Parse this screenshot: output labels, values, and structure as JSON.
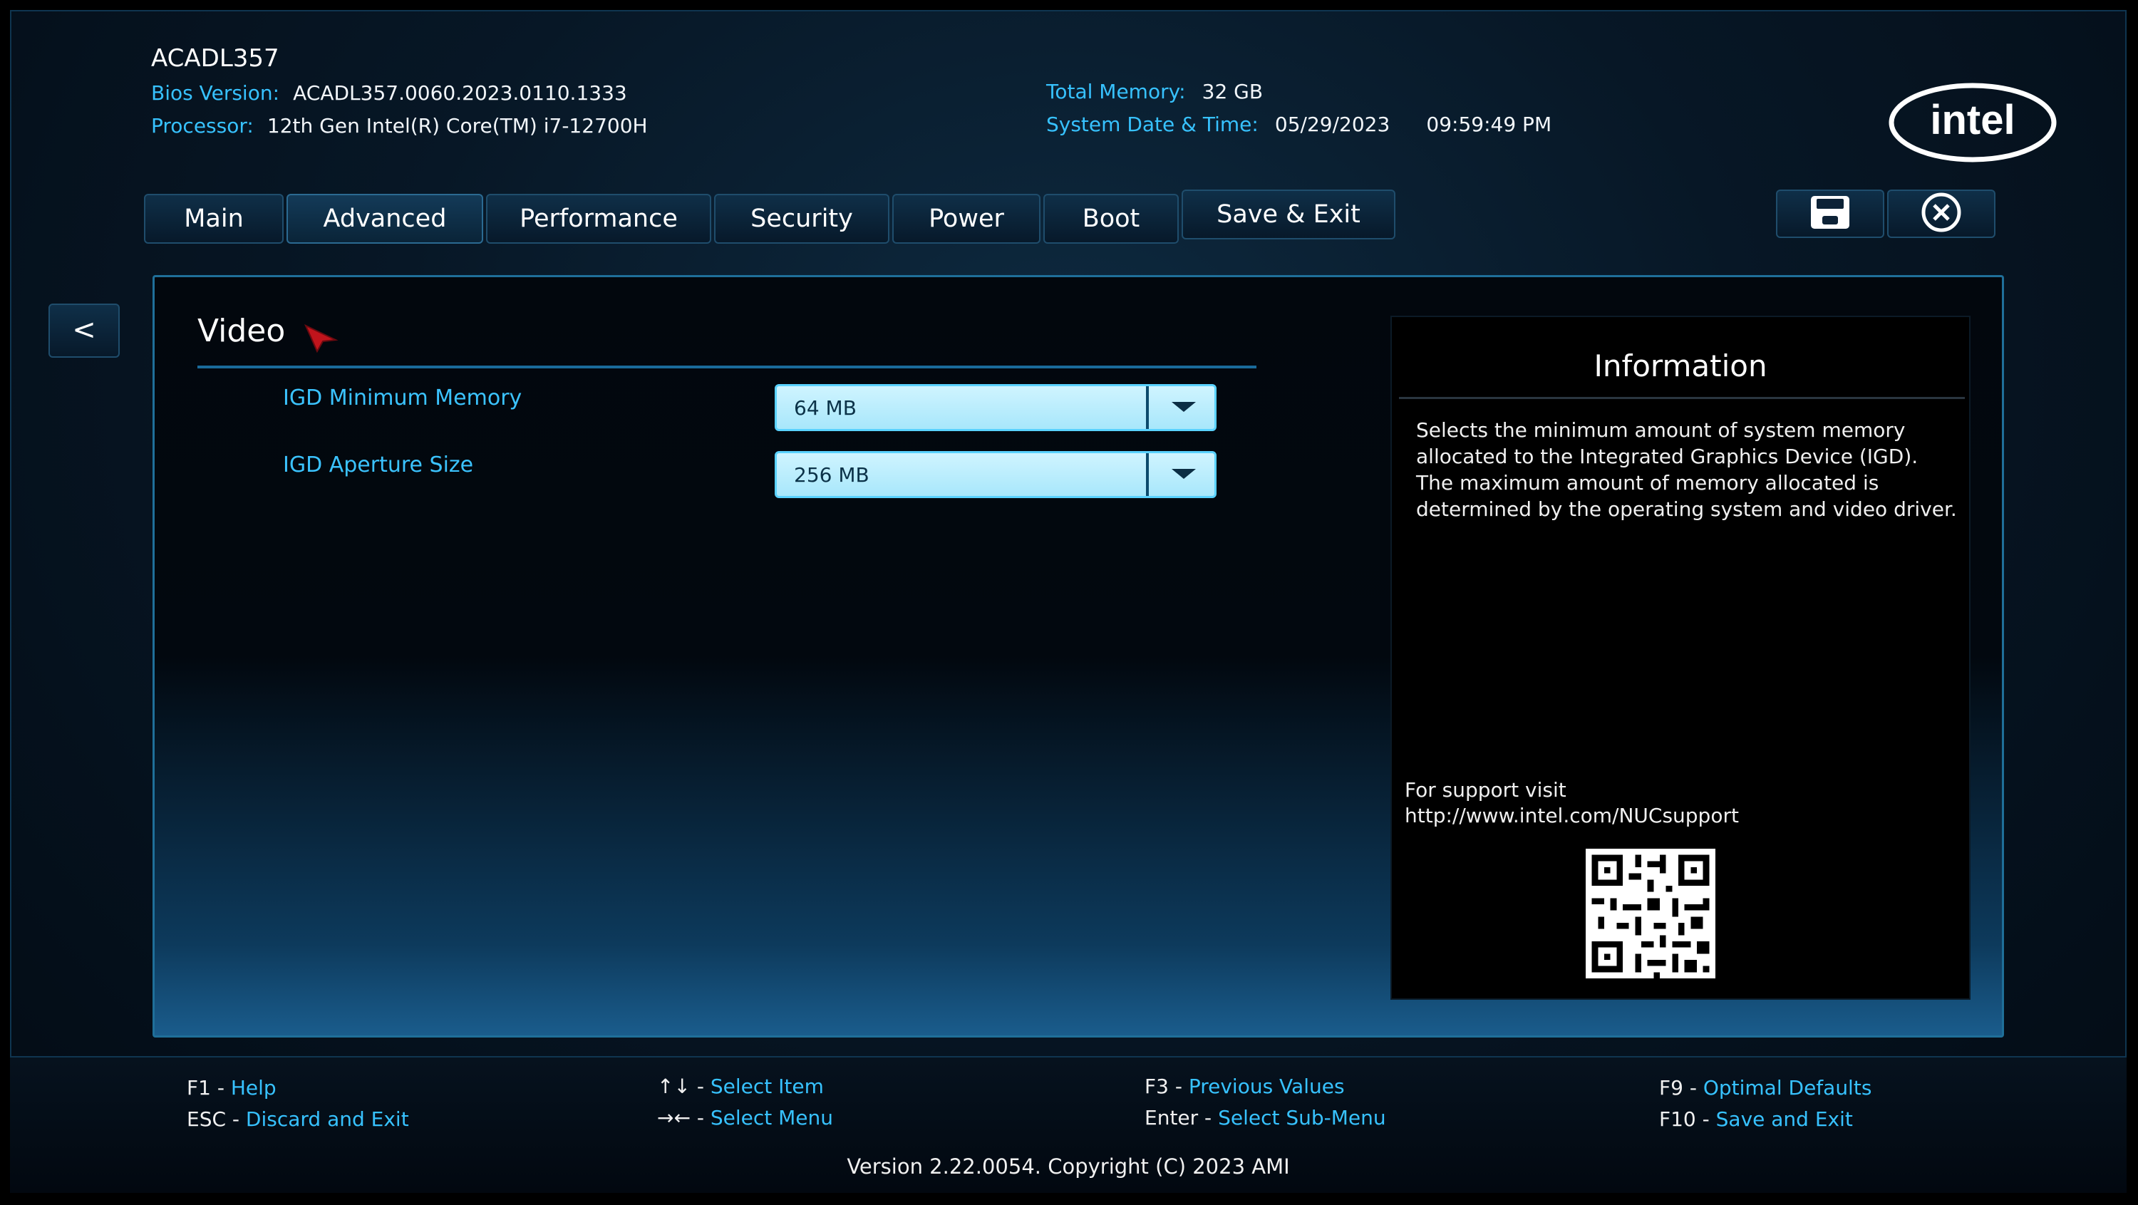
{
  "header": {
    "board": "ACADL357",
    "bios_label": "Bios Version:",
    "bios_value": "ACADL357.0060.2023.0110.1333",
    "processor_label": "Processor:",
    "processor_value": "12th Gen Intel(R) Core(TM) i7-12700H",
    "memory_label": "Total Memory:",
    "memory_value": "32 GB",
    "datetime_label": "System Date & Time:",
    "date_value": "05/29/2023",
    "time_value": "09:59:49 PM",
    "logo_text": "intel"
  },
  "tabs": [
    {
      "label": "Main"
    },
    {
      "label": "Advanced",
      "active": true
    },
    {
      "label": "Performance"
    },
    {
      "label": "Security"
    },
    {
      "label": "Power"
    },
    {
      "label": "Boot"
    },
    {
      "label": "Save & Exit"
    }
  ],
  "toolbar": {
    "save_icon": "save-icon",
    "exit_icon": "close-circle-icon"
  },
  "back_label": "<",
  "section": {
    "title": "Video",
    "settings": [
      {
        "label": "IGD Minimum Memory",
        "value": "64 MB"
      },
      {
        "label": "IGD Aperture Size",
        "value": "256 MB"
      }
    ]
  },
  "info": {
    "title": "Information",
    "text": "Selects the minimum amount of system memory allocated to the Integrated Graphics Device (IGD). The maximum amount of memory allocated is determined by the operating system and video driver.",
    "support_line1": "For support visit",
    "support_line2": "http://www.intel.com/NUCsupport"
  },
  "footer": {
    "f1_key": "F1",
    "f1_desc": "Help",
    "esc_key": "ESC",
    "esc_desc": "Discard and Exit",
    "item_key": "↑↓",
    "item_desc": "Select Item",
    "menu_key": "→←",
    "menu_desc": "Select Menu",
    "f3_key": "F3",
    "f3_desc": "Previous Values",
    "enter_key": "Enter",
    "enter_desc": "Select Sub-Menu",
    "f9_key": "F9",
    "f9_desc": "Optimal Defaults",
    "f10_key": "F10",
    "f10_desc": "Save and Exit",
    "version": "Version 2.22.0054. Copyright (C) 2023 AMI"
  },
  "colors": {
    "accent": "#37c2ff",
    "dropdown_bg": "#cff4ff",
    "panel_border": "#1f6f99"
  }
}
